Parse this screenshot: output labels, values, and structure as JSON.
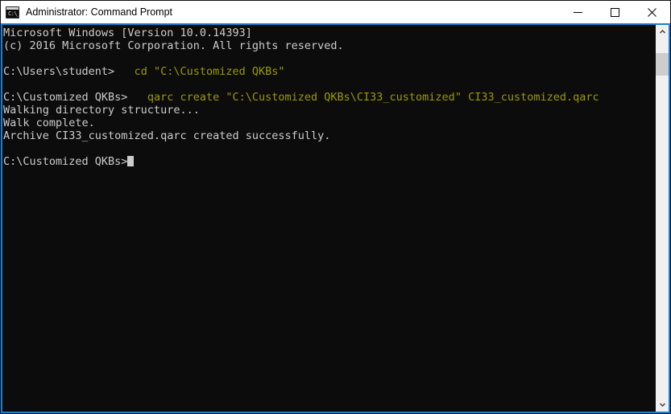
{
  "window": {
    "title": "Administrator: Command Prompt",
    "icon": "command-prompt-icon",
    "icon_glyph": "C:\\_",
    "active_border_color": "#1a7fd4",
    "controls": {
      "minimize_label": "Minimize",
      "maximize_label": "Maximize",
      "close_label": "Close"
    }
  },
  "console": {
    "background_color": "#0c0c0c",
    "foreground_color": "#cccccc",
    "command_color": "#9a9a00",
    "lines": [
      {
        "id": "line-1",
        "segments": [
          {
            "type": "output",
            "text": "Microsoft Windows [Version 10.0.14393]"
          }
        ]
      },
      {
        "id": "line-2",
        "segments": [
          {
            "type": "output",
            "text": "(c) 2016 Microsoft Corporation. All rights reserved."
          }
        ]
      },
      {
        "id": "line-3",
        "segments": [
          {
            "type": "output",
            "text": ""
          }
        ]
      },
      {
        "id": "line-4",
        "segments": [
          {
            "type": "output",
            "text": "C:\\Users\\student>   "
          },
          {
            "type": "command",
            "text": "cd \"C:\\Customized QKBs\""
          }
        ]
      },
      {
        "id": "line-5",
        "segments": [
          {
            "type": "output",
            "text": ""
          }
        ]
      },
      {
        "id": "line-6",
        "segments": [
          {
            "type": "output",
            "text": "C:\\Customized QKBs>   "
          },
          {
            "type": "command",
            "text": "qarc create \"C:\\Customized QKBs\\CI33_customized\" CI33_customized.qarc"
          }
        ]
      },
      {
        "id": "line-7",
        "segments": [
          {
            "type": "output",
            "text": "Walking directory structure..."
          }
        ]
      },
      {
        "id": "line-8",
        "segments": [
          {
            "type": "output",
            "text": "Walk complete."
          }
        ]
      },
      {
        "id": "line-9",
        "segments": [
          {
            "type": "output",
            "text": "Archive CI33_customized.qarc created successfully."
          }
        ]
      },
      {
        "id": "line-10",
        "segments": [
          {
            "type": "output",
            "text": ""
          }
        ]
      },
      {
        "id": "line-11",
        "segments": [
          {
            "type": "output",
            "text": "C:\\Customized QKBs>"
          }
        ],
        "cursor": true
      }
    ]
  },
  "scrollbar": {
    "up_label": "Scroll up",
    "down_label": "Scroll down",
    "track_color": "#f0f0f0",
    "thumb_color": "#cdcdcd"
  }
}
